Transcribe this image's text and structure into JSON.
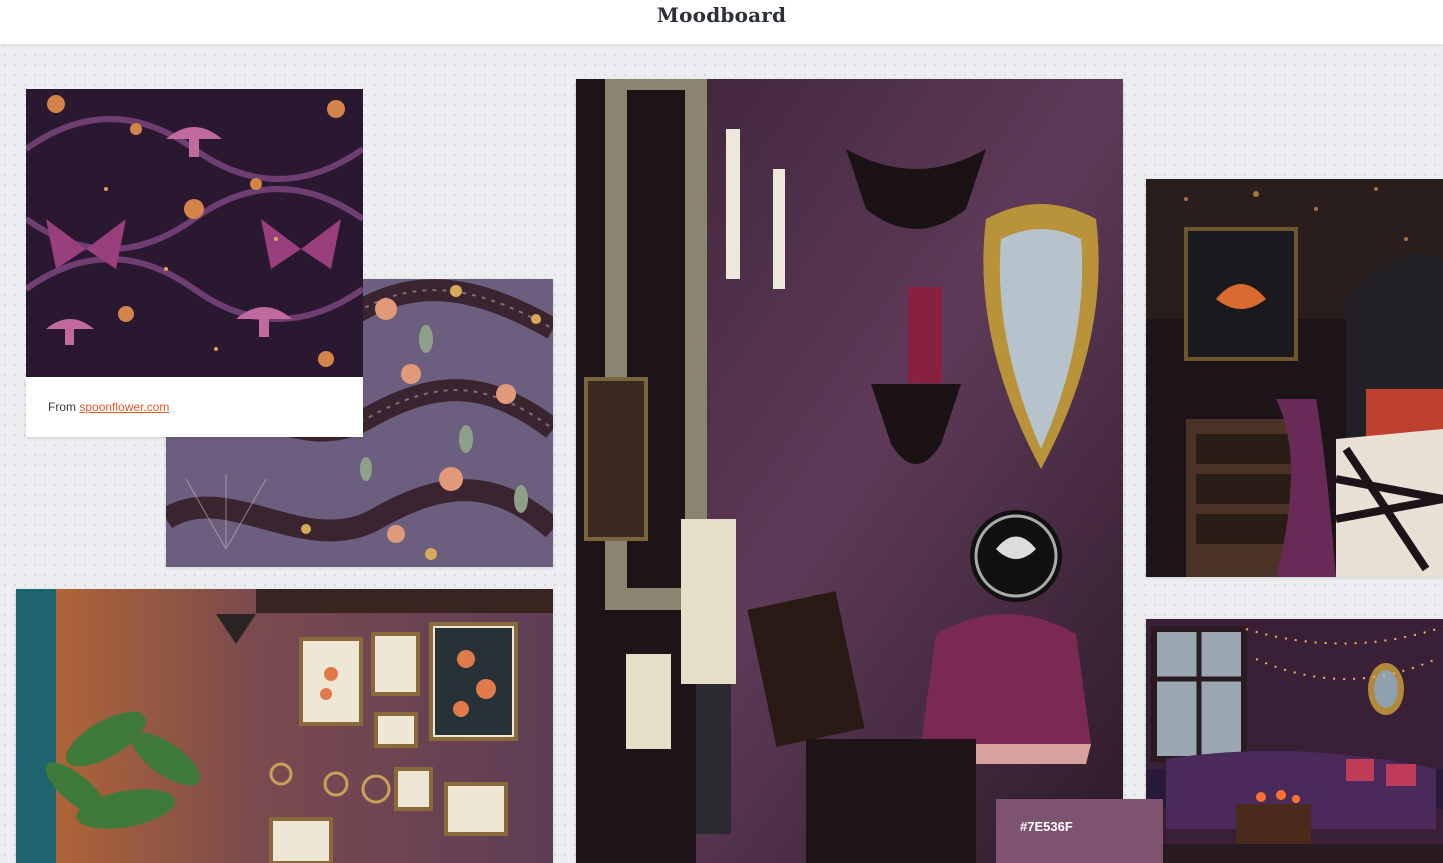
{
  "header": {
    "title": "Moodboard"
  },
  "cards": {
    "pattern_moths": {
      "icon": "moth-mushroom-pattern-image",
      "caption_prefix": "From",
      "caption_link": "spoonflower.com"
    },
    "pattern_snakes": {
      "icon": "snake-floral-pattern-image"
    },
    "gothic_wall": {
      "icon": "gothic-candle-wall-image"
    },
    "bedroom": {
      "icon": "dark-bedroom-image"
    },
    "gallery_wall": {
      "icon": "botanical-gallery-wall-image"
    },
    "living_room": {
      "icon": "fairy-light-living-room-image"
    }
  },
  "swatch": {
    "label": "#7E536F",
    "color": "#7E536F"
  },
  "colors": {
    "accent": "#e4582a",
    "plum": "#7E536F",
    "dark_purple": "#2a1830",
    "lavender": "#6c5e7e"
  }
}
